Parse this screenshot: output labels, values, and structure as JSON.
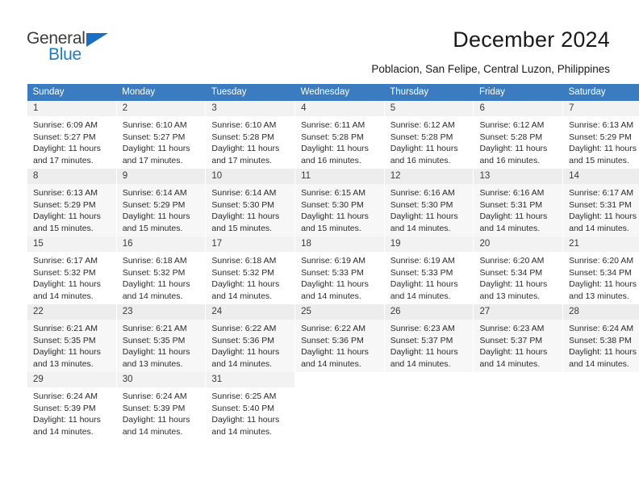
{
  "brand": {
    "name_part1": "General",
    "name_part2": "Blue",
    "triangle_color": "#1b6ec2",
    "blue_color": "#1f7bc1"
  },
  "header": {
    "title": "December 2024",
    "subtitle": "Poblacion, San Felipe, Central Luzon, Philippines"
  },
  "theme": {
    "header_row_bg": "#3a7cbf",
    "header_row_text": "#ffffff",
    "alt_row_bg": "#f7f7f7",
    "daynum_bg": "#f2f2f2"
  },
  "weekdays": [
    "Sunday",
    "Monday",
    "Tuesday",
    "Wednesday",
    "Thursday",
    "Friday",
    "Saturday"
  ],
  "weeks": [
    [
      {
        "day": "1",
        "sunrise": "Sunrise: 6:09 AM",
        "sunset": "Sunset: 5:27 PM",
        "daylight1": "Daylight: 11 hours",
        "daylight2": "and 17 minutes."
      },
      {
        "day": "2",
        "sunrise": "Sunrise: 6:10 AM",
        "sunset": "Sunset: 5:27 PM",
        "daylight1": "Daylight: 11 hours",
        "daylight2": "and 17 minutes."
      },
      {
        "day": "3",
        "sunrise": "Sunrise: 6:10 AM",
        "sunset": "Sunset: 5:28 PM",
        "daylight1": "Daylight: 11 hours",
        "daylight2": "and 17 minutes."
      },
      {
        "day": "4",
        "sunrise": "Sunrise: 6:11 AM",
        "sunset": "Sunset: 5:28 PM",
        "daylight1": "Daylight: 11 hours",
        "daylight2": "and 16 minutes."
      },
      {
        "day": "5",
        "sunrise": "Sunrise: 6:12 AM",
        "sunset": "Sunset: 5:28 PM",
        "daylight1": "Daylight: 11 hours",
        "daylight2": "and 16 minutes."
      },
      {
        "day": "6",
        "sunrise": "Sunrise: 6:12 AM",
        "sunset": "Sunset: 5:28 PM",
        "daylight1": "Daylight: 11 hours",
        "daylight2": "and 16 minutes."
      },
      {
        "day": "7",
        "sunrise": "Sunrise: 6:13 AM",
        "sunset": "Sunset: 5:29 PM",
        "daylight1": "Daylight: 11 hours",
        "daylight2": "and 15 minutes."
      }
    ],
    [
      {
        "day": "8",
        "sunrise": "Sunrise: 6:13 AM",
        "sunset": "Sunset: 5:29 PM",
        "daylight1": "Daylight: 11 hours",
        "daylight2": "and 15 minutes."
      },
      {
        "day": "9",
        "sunrise": "Sunrise: 6:14 AM",
        "sunset": "Sunset: 5:29 PM",
        "daylight1": "Daylight: 11 hours",
        "daylight2": "and 15 minutes."
      },
      {
        "day": "10",
        "sunrise": "Sunrise: 6:14 AM",
        "sunset": "Sunset: 5:30 PM",
        "daylight1": "Daylight: 11 hours",
        "daylight2": "and 15 minutes."
      },
      {
        "day": "11",
        "sunrise": "Sunrise: 6:15 AM",
        "sunset": "Sunset: 5:30 PM",
        "daylight1": "Daylight: 11 hours",
        "daylight2": "and 15 minutes."
      },
      {
        "day": "12",
        "sunrise": "Sunrise: 6:16 AM",
        "sunset": "Sunset: 5:30 PM",
        "daylight1": "Daylight: 11 hours",
        "daylight2": "and 14 minutes."
      },
      {
        "day": "13",
        "sunrise": "Sunrise: 6:16 AM",
        "sunset": "Sunset: 5:31 PM",
        "daylight1": "Daylight: 11 hours",
        "daylight2": "and 14 minutes."
      },
      {
        "day": "14",
        "sunrise": "Sunrise: 6:17 AM",
        "sunset": "Sunset: 5:31 PM",
        "daylight1": "Daylight: 11 hours",
        "daylight2": "and 14 minutes."
      }
    ],
    [
      {
        "day": "15",
        "sunrise": "Sunrise: 6:17 AM",
        "sunset": "Sunset: 5:32 PM",
        "daylight1": "Daylight: 11 hours",
        "daylight2": "and 14 minutes."
      },
      {
        "day": "16",
        "sunrise": "Sunrise: 6:18 AM",
        "sunset": "Sunset: 5:32 PM",
        "daylight1": "Daylight: 11 hours",
        "daylight2": "and 14 minutes."
      },
      {
        "day": "17",
        "sunrise": "Sunrise: 6:18 AM",
        "sunset": "Sunset: 5:32 PM",
        "daylight1": "Daylight: 11 hours",
        "daylight2": "and 14 minutes."
      },
      {
        "day": "18",
        "sunrise": "Sunrise: 6:19 AM",
        "sunset": "Sunset: 5:33 PM",
        "daylight1": "Daylight: 11 hours",
        "daylight2": "and 14 minutes."
      },
      {
        "day": "19",
        "sunrise": "Sunrise: 6:19 AM",
        "sunset": "Sunset: 5:33 PM",
        "daylight1": "Daylight: 11 hours",
        "daylight2": "and 14 minutes."
      },
      {
        "day": "20",
        "sunrise": "Sunrise: 6:20 AM",
        "sunset": "Sunset: 5:34 PM",
        "daylight1": "Daylight: 11 hours",
        "daylight2": "and 13 minutes."
      },
      {
        "day": "21",
        "sunrise": "Sunrise: 6:20 AM",
        "sunset": "Sunset: 5:34 PM",
        "daylight1": "Daylight: 11 hours",
        "daylight2": "and 13 minutes."
      }
    ],
    [
      {
        "day": "22",
        "sunrise": "Sunrise: 6:21 AM",
        "sunset": "Sunset: 5:35 PM",
        "daylight1": "Daylight: 11 hours",
        "daylight2": "and 13 minutes."
      },
      {
        "day": "23",
        "sunrise": "Sunrise: 6:21 AM",
        "sunset": "Sunset: 5:35 PM",
        "daylight1": "Daylight: 11 hours",
        "daylight2": "and 13 minutes."
      },
      {
        "day": "24",
        "sunrise": "Sunrise: 6:22 AM",
        "sunset": "Sunset: 5:36 PM",
        "daylight1": "Daylight: 11 hours",
        "daylight2": "and 14 minutes."
      },
      {
        "day": "25",
        "sunrise": "Sunrise: 6:22 AM",
        "sunset": "Sunset: 5:36 PM",
        "daylight1": "Daylight: 11 hours",
        "daylight2": "and 14 minutes."
      },
      {
        "day": "26",
        "sunrise": "Sunrise: 6:23 AM",
        "sunset": "Sunset: 5:37 PM",
        "daylight1": "Daylight: 11 hours",
        "daylight2": "and 14 minutes."
      },
      {
        "day": "27",
        "sunrise": "Sunrise: 6:23 AM",
        "sunset": "Sunset: 5:37 PM",
        "daylight1": "Daylight: 11 hours",
        "daylight2": "and 14 minutes."
      },
      {
        "day": "28",
        "sunrise": "Sunrise: 6:24 AM",
        "sunset": "Sunset: 5:38 PM",
        "daylight1": "Daylight: 11 hours",
        "daylight2": "and 14 minutes."
      }
    ],
    [
      {
        "day": "29",
        "sunrise": "Sunrise: 6:24 AM",
        "sunset": "Sunset: 5:39 PM",
        "daylight1": "Daylight: 11 hours",
        "daylight2": "and 14 minutes."
      },
      {
        "day": "30",
        "sunrise": "Sunrise: 6:24 AM",
        "sunset": "Sunset: 5:39 PM",
        "daylight1": "Daylight: 11 hours",
        "daylight2": "and 14 minutes."
      },
      {
        "day": "31",
        "sunrise": "Sunrise: 6:25 AM",
        "sunset": "Sunset: 5:40 PM",
        "daylight1": "Daylight: 11 hours",
        "daylight2": "and 14 minutes."
      },
      {
        "day": "",
        "sunrise": "",
        "sunset": "",
        "daylight1": "",
        "daylight2": ""
      },
      {
        "day": "",
        "sunrise": "",
        "sunset": "",
        "daylight1": "",
        "daylight2": ""
      },
      {
        "day": "",
        "sunrise": "",
        "sunset": "",
        "daylight1": "",
        "daylight2": ""
      },
      {
        "day": "",
        "sunrise": "",
        "sunset": "",
        "daylight1": "",
        "daylight2": ""
      }
    ]
  ]
}
